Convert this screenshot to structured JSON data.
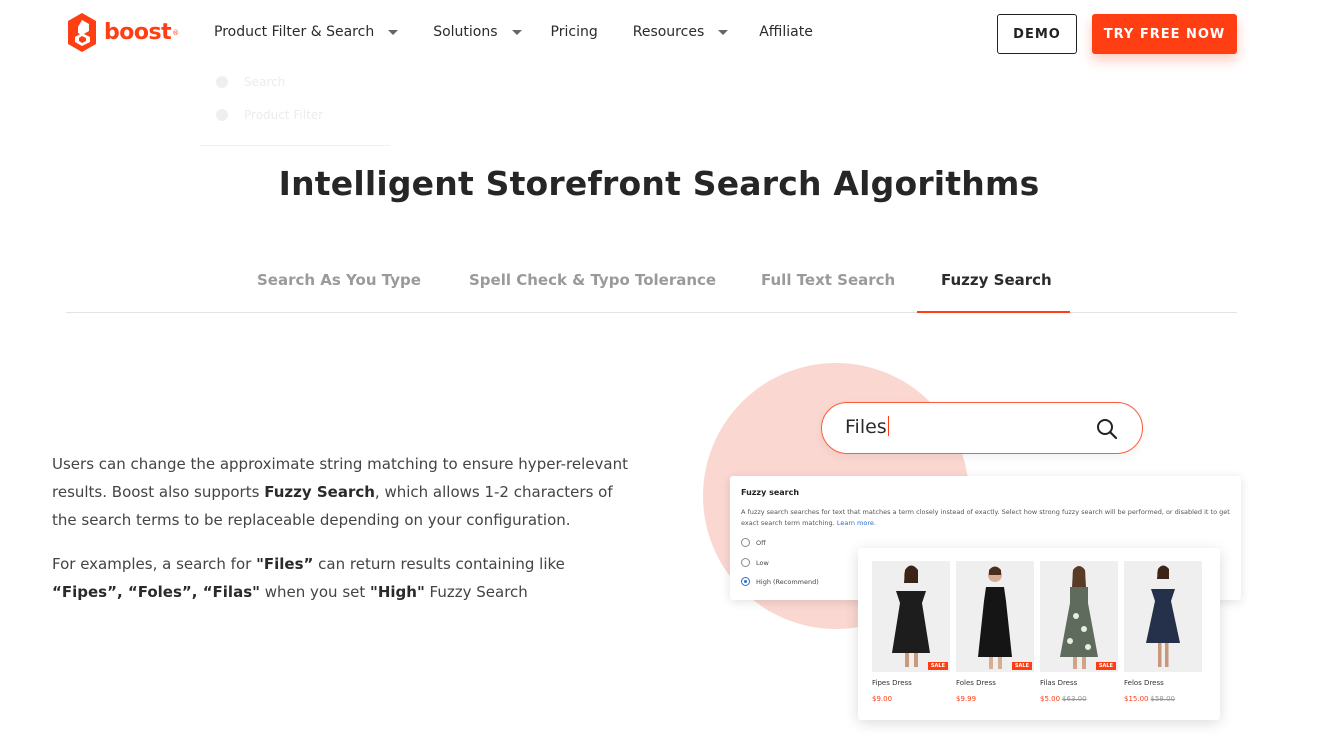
{
  "brand": {
    "name": "boost",
    "registered": "®",
    "color": "#ff3e14"
  },
  "nav": {
    "items": [
      {
        "label": "Product Filter & Search",
        "dropdown": true
      },
      {
        "label": "Solutions",
        "dropdown": true
      },
      {
        "label": "Pricing",
        "dropdown": false
      },
      {
        "label": "Resources",
        "dropdown": true
      },
      {
        "label": "Affiliate",
        "dropdown": false
      }
    ],
    "demo_label": "DEMO",
    "try_label": "TRY FREE NOW"
  },
  "ghost_menu": {
    "items": [
      "Search",
      "Product Filter"
    ]
  },
  "section": {
    "title": "Intelligent Storefront Search Algorithms"
  },
  "tabs": [
    {
      "label": "Search As You Type",
      "active": false
    },
    {
      "label": "Spell Check & Typo Tolerance",
      "active": false
    },
    {
      "label": "Full Text Search",
      "active": false
    },
    {
      "label": "Fuzzy Search",
      "active": true
    }
  ],
  "copy": {
    "p1_a": "Users can change the approximate string matching to ensure hyper-relevant results. Boost also supports ",
    "p1_b": "Fuzzy Search",
    "p1_c": ", which allows 1-2 characters of the search terms to be replaceable depending on your configuration.",
    "p2_a": "For examples, a search for ",
    "p2_b": "\"Files”",
    "p2_c": " can return results containing like ",
    "p2_d": "“Fipes”, “Foles”, “Filas\"",
    "p2_e": " when you set ",
    "p2_f": "\"High\"",
    "p2_g": " Fuzzy Search"
  },
  "demo": {
    "search_value": "Files",
    "panel_title": "Fuzzy search",
    "panel_desc": "A fuzzy search searches for text that matches a term closely instead of exactly. Select how strong fuzzy search will be  performed, or disabled it to get exact search term matching.",
    "panel_link": "Learn more.",
    "options": [
      {
        "label": "Off",
        "selected": false
      },
      {
        "label": "Low",
        "selected": false
      },
      {
        "label": "High (Recommend)",
        "selected": true
      }
    ],
    "products": [
      {
        "name": "Fipes Dress",
        "price": "$9.00",
        "old_price": "",
        "sale": "SALE",
        "dress_color": "#1d1d1d"
      },
      {
        "name": "Foles Dress",
        "price": "$9.99",
        "old_price": "",
        "sale": "SALE",
        "dress_color": "#151515"
      },
      {
        "name": "Filas Dress",
        "price": "$5.00",
        "old_price": "$63.00",
        "sale": "SALE",
        "dress_color": "#5f6b5c"
      },
      {
        "name": "Felos Dress",
        "price": "$15.00",
        "old_price": "$58.00",
        "sale": "",
        "dress_color": "#25304a"
      }
    ]
  }
}
